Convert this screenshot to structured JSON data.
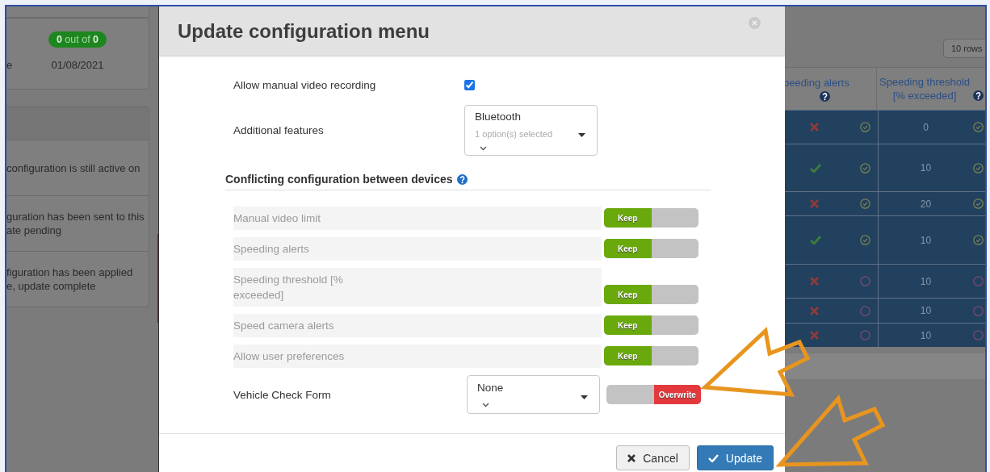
{
  "background_left": {
    "badge": "**0** out of **0**",
    "date_label": "e",
    "date": "01/08/2021",
    "statuses": [
      "configuration is still active on",
      "guration has been sent to this\nate pending",
      "figuration has been applied\ne, update complete"
    ]
  },
  "modal": {
    "title": "Update configuration menu",
    "settings": [
      {
        "kind": "checkbox",
        "label": "Allow manual video recording",
        "checked": true
      },
      {
        "kind": "multiselect",
        "label": "Additional features",
        "value": "Bluetooth",
        "summary": "1 option(s) selected"
      }
    ],
    "conflicts_heading": "Conflicting configuration between devices",
    "conflicts": [
      {
        "kind": "plain",
        "label": "Manual video limit",
        "overwrite": false,
        "toggle_label": "Keep"
      },
      {
        "kind": "plain",
        "label": "Speeding alerts",
        "overwrite": false,
        "toggle_label": "Keep"
      },
      {
        "kind": "plain",
        "label": "Speeding threshold [% exceeded]",
        "overwrite": false,
        "toggle_label": "Keep"
      },
      {
        "kind": "plain",
        "label": "Speed camera alerts",
        "overwrite": false,
        "toggle_label": "Keep"
      },
      {
        "kind": "plain",
        "label": "Allow user preferences",
        "overwrite": false,
        "toggle_label": "Keep"
      },
      {
        "kind": "select",
        "label": "Vehicle Check Form",
        "value": "None",
        "overwrite": true,
        "toggle_label": "Overwrite"
      }
    ],
    "buttons": [
      {
        "kind": "cancel",
        "label": "Cancel"
      },
      {
        "kind": "update",
        "label": "Update"
      }
    ]
  },
  "background_table": {
    "rows_button": "10 rows",
    "columns": [
      "peeding alerts",
      "Speeding threshold [% exceeded]"
    ],
    "rows": [
      {
        "speeding_alert": false,
        "alert_applied": true,
        "threshold": "0",
        "threshold_applied": true
      },
      {
        "speeding_alert": true,
        "alert_applied": true,
        "threshold": "10",
        "threshold_applied": true
      },
      {
        "speeding_alert": false,
        "alert_applied": true,
        "threshold": "20",
        "threshold_applied": true
      },
      {
        "speeding_alert": true,
        "alert_applied": true,
        "threshold": "10",
        "threshold_applied": true
      },
      {
        "speeding_alert": false,
        "alert_applied": false,
        "threshold": "10",
        "threshold_applied": false
      },
      {
        "speeding_alert": false,
        "alert_applied": false,
        "threshold": "10",
        "threshold_applied": false
      },
      {
        "speeding_alert": false,
        "alert_applied": false,
        "threshold": "10",
        "threshold_applied": false
      }
    ]
  }
}
